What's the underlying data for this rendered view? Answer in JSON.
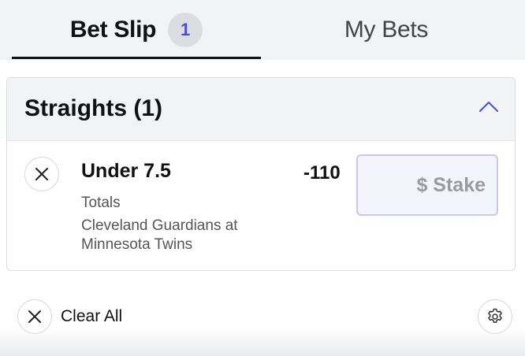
{
  "tabs": {
    "bet_slip_label": "Bet Slip",
    "bet_slip_count": "1",
    "my_bets_label": "My Bets",
    "active": "Bet Slip"
  },
  "section": {
    "title": "Straights (1)",
    "collapse_icon": "chevron-up-icon",
    "expanded": true
  },
  "bet": {
    "selection": "Under 7.5",
    "market": "Totals",
    "event": "Cleveland Guardians at Minnesota Twins",
    "odds": "-110",
    "stake_placeholder": "$ Stake",
    "stake_value": "",
    "remove_icon": "close-icon"
  },
  "footer": {
    "clear_all_label": "Clear All",
    "clear_icon": "close-icon",
    "settings_icon": "gear-icon"
  },
  "colors": {
    "accent": "#4a4fd6",
    "badge_bg": "#dcdde0",
    "header_bg": "#f2f3f5",
    "stake_border": "#c6c8ef",
    "stake_bg": "#f4f4fc"
  }
}
